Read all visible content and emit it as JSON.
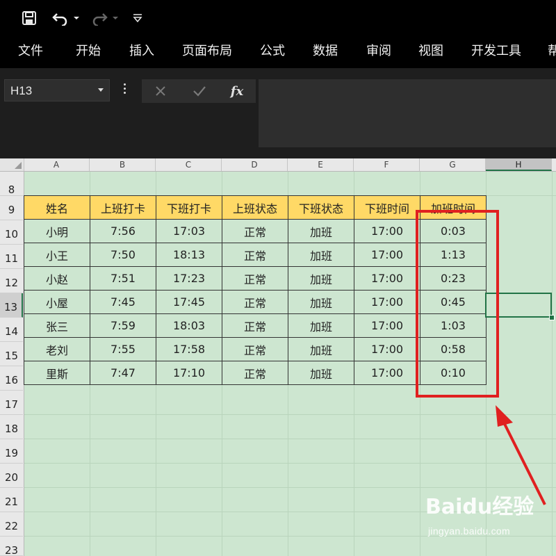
{
  "quick_access": {
    "save_icon": "save-icon",
    "undo_icon": "undo-icon",
    "redo_icon": "redo-icon",
    "customize_icon": "customize-qat-icon"
  },
  "ribbon_tabs": [
    "文件",
    "开始",
    "插入",
    "页面布局",
    "公式",
    "数据",
    "审阅",
    "视图",
    "开发工具",
    "帮"
  ],
  "formula_bar": {
    "name_box": "H13",
    "cancel_icon": "cancel-icon",
    "enter_icon": "checkmark-icon",
    "fx_label": "fx",
    "formula": ""
  },
  "columns": [
    "A",
    "B",
    "C",
    "D",
    "E",
    "F",
    "G",
    "H"
  ],
  "selected_column": "H",
  "rows": [
    "8",
    "9",
    "10",
    "11",
    "12",
    "13",
    "14",
    "15",
    "16",
    "17",
    "18",
    "19",
    "20",
    "21",
    "22",
    "23"
  ],
  "selected_row": "13",
  "table": {
    "headers": [
      "姓名",
      "上班打卡",
      "下班打卡",
      "上班状态",
      "下班状态",
      "下班时间",
      "加班时间"
    ],
    "rows": [
      [
        "小明",
        "7:56",
        "17:03",
        "正常",
        "加班",
        "17:00",
        "0:03"
      ],
      [
        "小王",
        "7:50",
        "18:13",
        "正常",
        "加班",
        "17:00",
        "1:13"
      ],
      [
        "小赵",
        "7:51",
        "17:23",
        "正常",
        "加班",
        "17:00",
        "0:23"
      ],
      [
        "小屋",
        "7:45",
        "17:45",
        "正常",
        "加班",
        "17:00",
        "0:45"
      ],
      [
        "张三",
        "7:59",
        "18:03",
        "正常",
        "加班",
        "17:00",
        "1:03"
      ],
      [
        "老刘",
        "7:55",
        "17:58",
        "正常",
        "加班",
        "17:00",
        "0:58"
      ],
      [
        "里斯",
        "7:47",
        "17:10",
        "正常",
        "加班",
        "17:00",
        "0:10"
      ]
    ]
  },
  "annotation": {
    "highlight_color": "#e02020"
  },
  "watermark": {
    "logo_text": "Baidu经验",
    "url": "jingyan.baidu.com"
  },
  "colors": {
    "header_fill": "#ffd966",
    "sheet_background": "#cde6d0",
    "selection_green": "#217346"
  }
}
